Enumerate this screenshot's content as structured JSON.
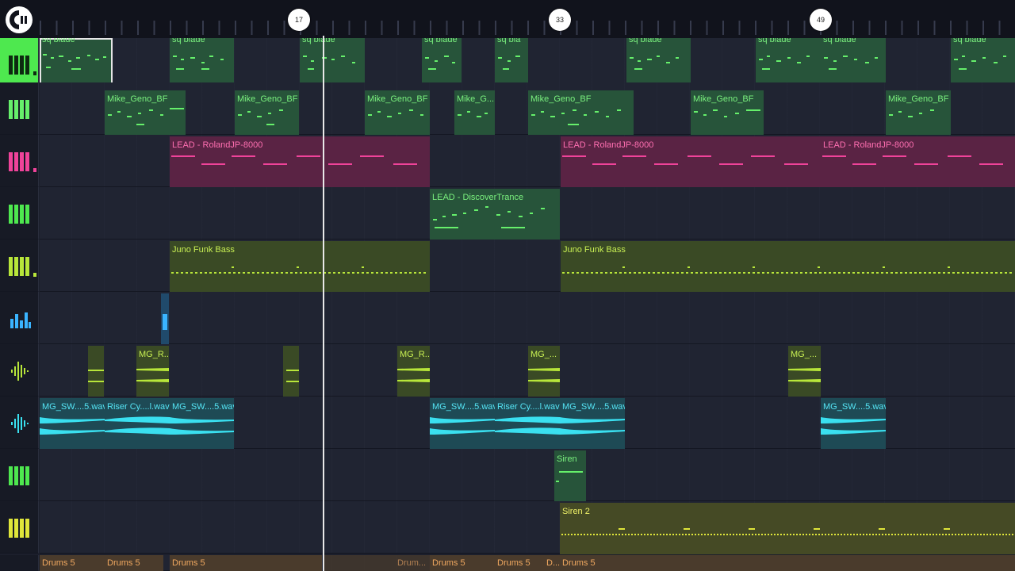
{
  "timeline": {
    "markers": [
      "17",
      "33",
      "49"
    ]
  },
  "colors": {
    "accent": "#4ee84f",
    "pink": "#f0439a",
    "olive": "#b8e63a",
    "blue": "#3ab4ff",
    "teal": "#3ae0f0",
    "yellow": "#dfe63a",
    "drums": "#f0a860"
  },
  "tracks": [
    {
      "icon": "piano-keys-icon",
      "clips": [
        {
          "name": "sq blade"
        },
        {
          "name": "sq blade"
        },
        {
          "name": "sq blade"
        },
        {
          "name": "sq blade"
        },
        {
          "name": "sq bla"
        },
        {
          "name": "sq blade"
        },
        {
          "name": "sq blade"
        },
        {
          "name": "sq blade"
        },
        {
          "name": "sq blade"
        }
      ]
    },
    {
      "icon": "piano-keys-icon",
      "clips": [
        {
          "name": "Mike_Geno_BF"
        },
        {
          "name": "Mike_Geno_BF"
        },
        {
          "name": "Mike_Geno_BF"
        },
        {
          "name": "Mike_G..."
        },
        {
          "name": "Mike_Geno_BF"
        },
        {
          "name": "Mike_Geno_BF"
        },
        {
          "name": "Mike_Geno_BF"
        }
      ]
    },
    {
      "icon": "piano-keys-icon",
      "clips": [
        {
          "name": "LEAD - RolandJP-8000"
        },
        {
          "name": "LEAD - RolandJP-8000"
        },
        {
          "name": "LEAD - RolandJP-8000"
        }
      ]
    },
    {
      "icon": "piano-keys-icon",
      "clips": [
        {
          "name": "LEAD - DiscoverTrance"
        }
      ]
    },
    {
      "icon": "piano-keys-icon",
      "clips": [
        {
          "name": "Juno Funk Bass"
        },
        {
          "name": "Juno Funk Bass"
        }
      ]
    },
    {
      "icon": "drum-pad-icon",
      "clips": [
        {
          "name": ""
        }
      ]
    },
    {
      "icon": "waveform-icon",
      "clips": [
        {
          "name": ""
        },
        {
          "name": "MG_R..."
        },
        {
          "name": ""
        },
        {
          "name": "MG_R..."
        },
        {
          "name": "MG_..."
        },
        {
          "name": "MG_..."
        }
      ]
    },
    {
      "icon": "waveform-icon",
      "clips": [
        {
          "name": "MG_SW....5.wav"
        },
        {
          "name": "Riser Cy....l.wav"
        },
        {
          "name": "MG_SW....5.wav"
        },
        {
          "name": "MG_SW....5.wav"
        },
        {
          "name": "Riser Cy....l.wav"
        },
        {
          "name": "MG_SW....5.wav"
        },
        {
          "name": "MG_SW....5.wav"
        }
      ]
    },
    {
      "icon": "piano-keys-icon",
      "clips": [
        {
          "name": "Siren"
        }
      ]
    },
    {
      "icon": "piano-keys-icon",
      "clips": [
        {
          "name": "Siren 2"
        }
      ]
    }
  ],
  "drums": {
    "clips": [
      {
        "name": "Drums 5"
      },
      {
        "name": "Drums 5"
      },
      {
        "name": "Drums 5"
      },
      {
        "name": "Drum..."
      },
      {
        "name": "Drums 5"
      },
      {
        "name": "Drums 5"
      },
      {
        "name": "D..."
      },
      {
        "name": "Drums 5"
      }
    ]
  }
}
